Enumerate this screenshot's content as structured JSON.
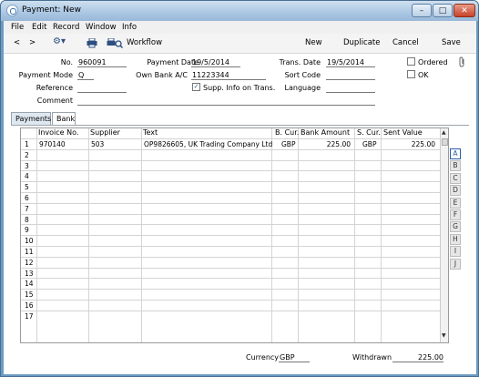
{
  "window": {
    "title": "Payment: New",
    "minimize": "–",
    "maximize": "□",
    "close": "✕"
  },
  "menu": [
    "File",
    "Edit",
    "Record",
    "Window",
    "Info"
  ],
  "toolbar": {
    "back": "<",
    "forward": ">",
    "gear": "⚙▾",
    "workflow": "Workflow",
    "new": "New",
    "duplicate": "Duplicate",
    "cancel": "Cancel",
    "save": "Save"
  },
  "form": {
    "no_label": "No.",
    "no_value": "960091",
    "payment_date_label": "Payment Date",
    "payment_date_value": "19/5/2014",
    "trans_date_label": "Trans. Date",
    "trans_date_value": "19/5/2014",
    "payment_mode_label": "Payment Mode",
    "payment_mode_value": "Q",
    "own_bank_label": "Own Bank A/C",
    "own_bank_value": "11223344",
    "sort_code_label": "Sort Code",
    "sort_code_value": "",
    "reference_label": "Reference",
    "reference_value": "",
    "supp_info_label": "Supp. Info on Trans.",
    "supp_info_checked": "✓",
    "language_label": "Language",
    "language_value": "",
    "comment_label": "Comment",
    "comment_value": "",
    "ordered_label": "Ordered",
    "ok_label": "OK"
  },
  "tabs": [
    "Payments",
    "Bank"
  ],
  "grid": {
    "headers": [
      "Invoice No.",
      "Supplier",
      "Text",
      "B. Cur.",
      "Bank Amount",
      "S. Cur.",
      "Sent Value"
    ],
    "row_numbers": [
      "1",
      "2",
      "3",
      "4",
      "5",
      "6",
      "7",
      "8",
      "9",
      "10",
      "11",
      "12",
      "13",
      "14",
      "15",
      "16",
      "17"
    ],
    "rows": [
      {
        "invoice": "970140",
        "supplier": "503",
        "text": "OP9826605, UK Trading Company Ltd",
        "bcur": "GBP",
        "bank_amount": "225.00",
        "scur": "GBP",
        "sent_value": "225.00"
      }
    ]
  },
  "letters": [
    "A",
    "B",
    "C",
    "D",
    "E",
    "F",
    "G",
    "H",
    "I",
    "J"
  ],
  "footer": {
    "currency_label": "Currency",
    "currency_value": "GBP",
    "withdrawn_label": "Withdrawn",
    "withdrawn_value": "225.00"
  }
}
